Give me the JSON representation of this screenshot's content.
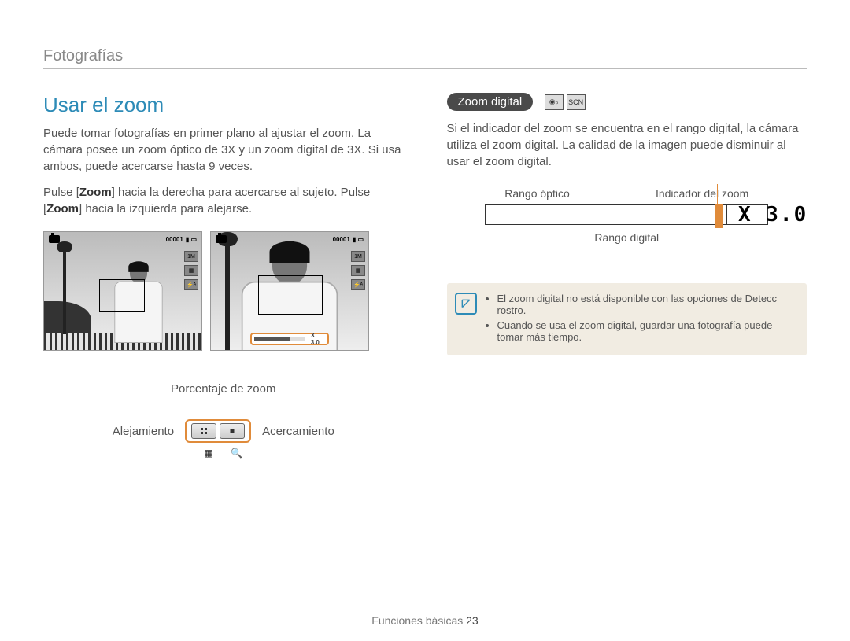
{
  "header": {
    "section": "Fotografías"
  },
  "left": {
    "title": "Usar el zoom",
    "p1": "Puede tomar fotografías en primer plano al ajustar el zoom. La cámara posee un zoom óptico de 3X y un zoom digital de 3X. Si usa ambos, puede acercarse hasta 9 veces.",
    "p2a": "Pulse [",
    "p2b": "Zoom",
    "p2c": "] hacia la derecha para acercarse al sujeto. Pulse [",
    "p2d": "Zoom",
    "p2e": "] hacia la izquierda para alejarse.",
    "preview": {
      "counter": "00001",
      "sideIcon1": "1M",
      "zoomBarLabel": "X 3.0"
    },
    "callout": "Porcentaje de zoom",
    "control": {
      "left": "Alejamiento",
      "right": "Acercamiento"
    }
  },
  "right": {
    "badge": "Zoom digital",
    "p1": "Si el indicador del zoom se encuentra en el rango digital, la cámara utiliza el zoom digital. La calidad de la imagen puede disminuir al usar el zoom digital.",
    "diagram": {
      "optic": "Rango óptico",
      "indicator": "Indicador del zoom",
      "digital": "Rango digital",
      "value": "X 3.0"
    },
    "notes": [
      "El zoom digital no está disponible con las opciones de Detecc rostro.",
      "Cuando se usa el zoom digital, guardar una fotografía puede tomar más tiempo."
    ]
  },
  "footer": {
    "label": "Funciones básicas",
    "page": "23"
  }
}
